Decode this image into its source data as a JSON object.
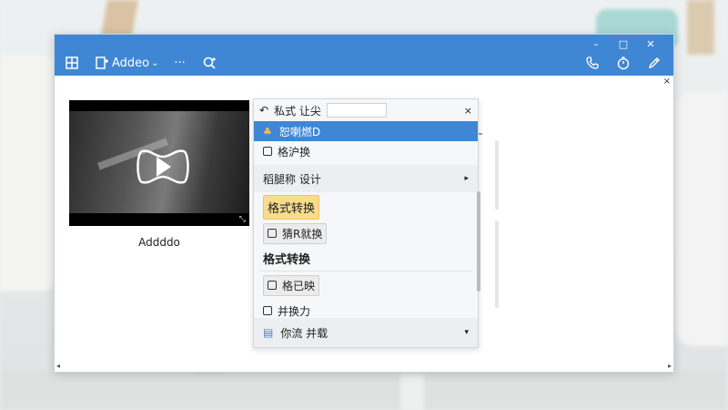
{
  "window": {
    "controls": {
      "minimize": "–",
      "maximize": "□",
      "close": "✕"
    },
    "corner_close": "×"
  },
  "toolbar": {
    "items": [
      {
        "icon": "layout-icon"
      },
      {
        "icon": "add-note-icon",
        "label": "Addeo",
        "dropdown": "⌄"
      },
      {
        "icon": "more-icon",
        "label": "···"
      },
      {
        "icon": "search-icon"
      }
    ],
    "right_icons": [
      "phone-icon",
      "timer-icon",
      "pen-icon"
    ]
  },
  "video": {
    "caption": "Addddo"
  },
  "menu": {
    "header": {
      "back": "↶",
      "label": "私式 让尖",
      "close": "×"
    },
    "selected_item": {
      "label": "恕喇燃D"
    },
    "items": {
      "item1": "格沪换",
      "submenu1": "稻腿称 设计",
      "item_yellow": "格式转换",
      "item2": "猜R就换",
      "item_bold": "格式转换",
      "item3": "格已映",
      "item4": "并换力"
    },
    "submenu_arrow": "▸",
    "footer": {
      "label": "你流 并载",
      "arrow": "▾"
    }
  },
  "scroll": {
    "left_arrow": "◂",
    "right_arrow": "▸"
  }
}
